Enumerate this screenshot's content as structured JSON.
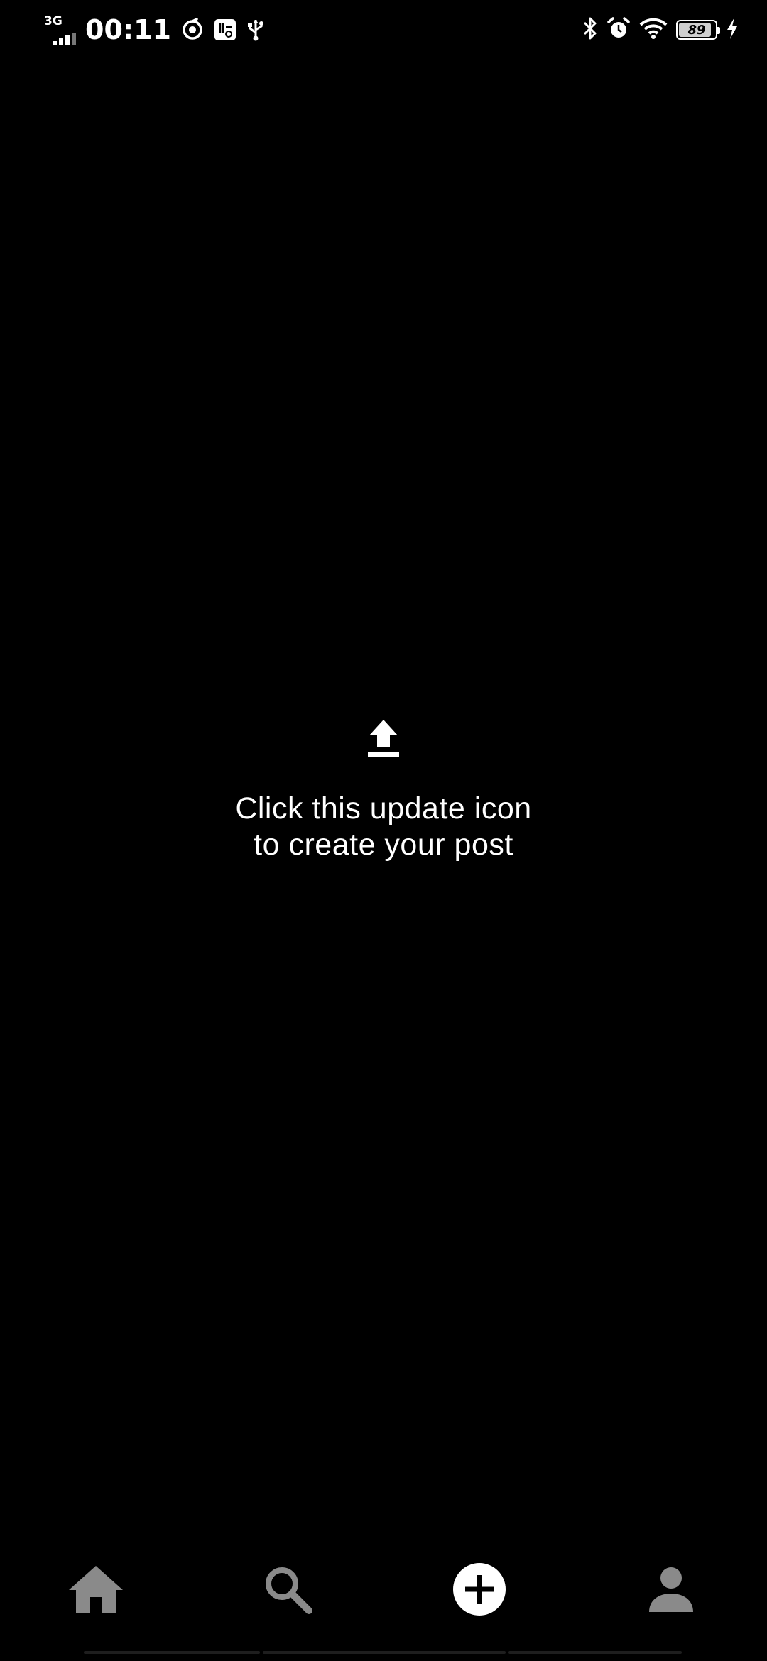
{
  "status_bar": {
    "network_type": "3G",
    "time": "00:11",
    "left_icons": [
      "sync-icon",
      "image-app-icon",
      "usb-icon"
    ],
    "right_icons": [
      "bluetooth-icon",
      "alarm-icon",
      "wifi-icon",
      "battery-icon",
      "charging-icon"
    ],
    "battery_level": "89",
    "battery_fraction": 0.89
  },
  "main": {
    "icon": "upload-icon",
    "message_line1": "Click this update icon",
    "message_line2": "to create your post"
  },
  "bottom_nav": {
    "items": [
      {
        "icon": "home-icon",
        "color": "#8a8a8a"
      },
      {
        "icon": "search-icon",
        "color": "#8a8a8a"
      },
      {
        "icon": "add-post-icon",
        "color": "#ffffff"
      },
      {
        "icon": "profile-icon",
        "color": "#8a8a8a"
      }
    ]
  }
}
